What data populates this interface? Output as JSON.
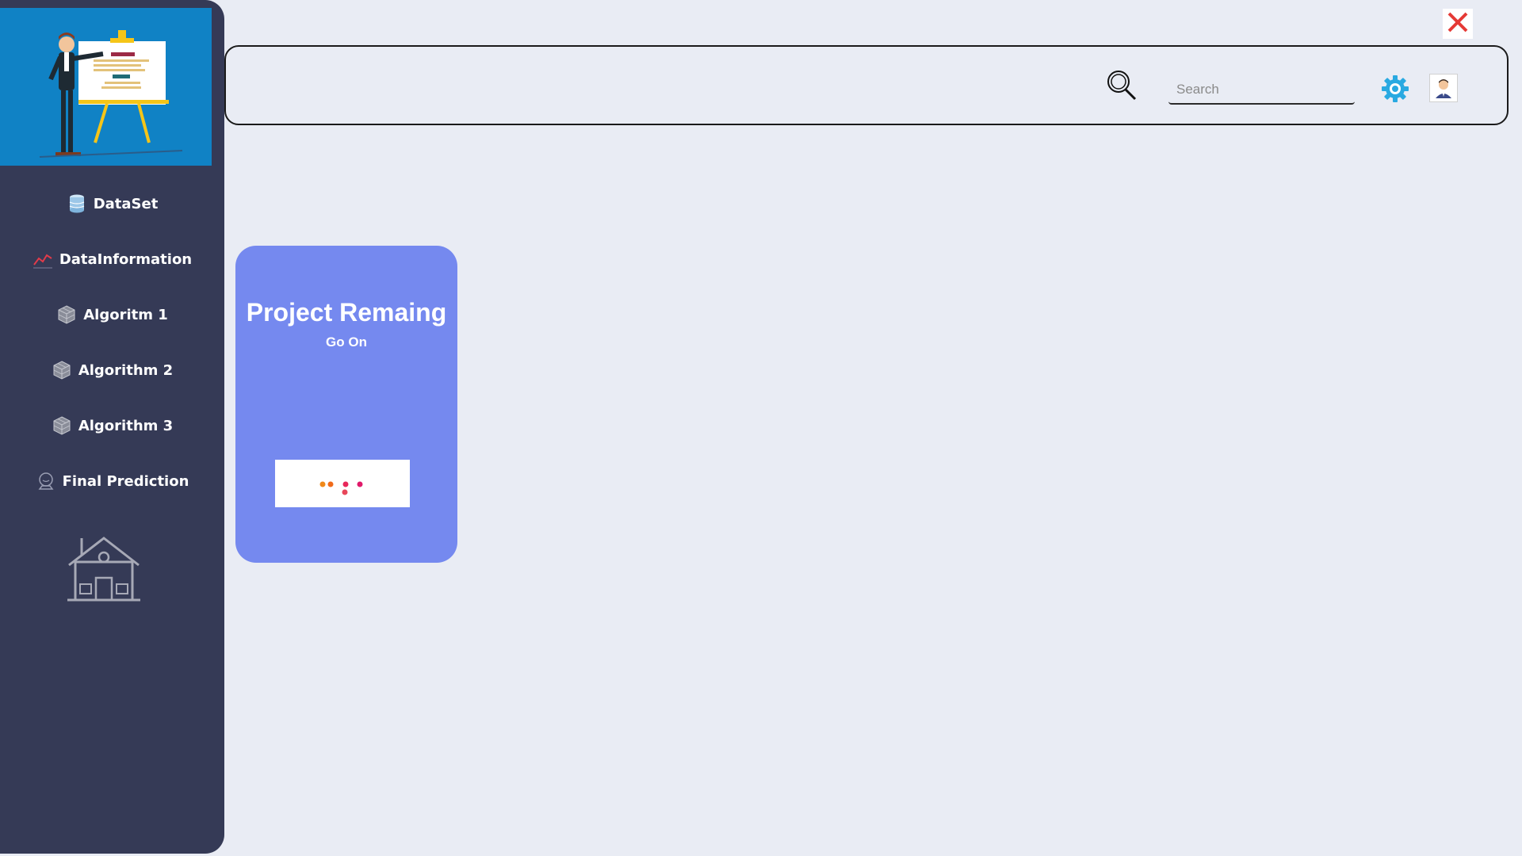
{
  "window": {
    "close_label": "Close"
  },
  "sidebar": {
    "items": [
      {
        "label": "DataSet",
        "icon": "database-icon"
      },
      {
        "label": "DataInformation",
        "icon": "line-chart-icon"
      },
      {
        "label": "Algoritm 1",
        "icon": "cube-icon"
      },
      {
        "label": "Algorithm 2",
        "icon": "cube-icon"
      },
      {
        "label": "Algorithm 3",
        "icon": "cube-icon"
      },
      {
        "label": "Final Prediction",
        "icon": "crystal-ball-icon"
      }
    ],
    "home_icon": "house-icon"
  },
  "header": {
    "search_placeholder": "Search"
  },
  "card": {
    "title": "Project Remaing",
    "subtitle": "Go On"
  },
  "colors": {
    "background": "#e9ecf4",
    "sidebar": "#353a56",
    "hero": "#1082c5",
    "card": "#7589ef",
    "close": "#e53935",
    "gear": "#29a9e1"
  }
}
